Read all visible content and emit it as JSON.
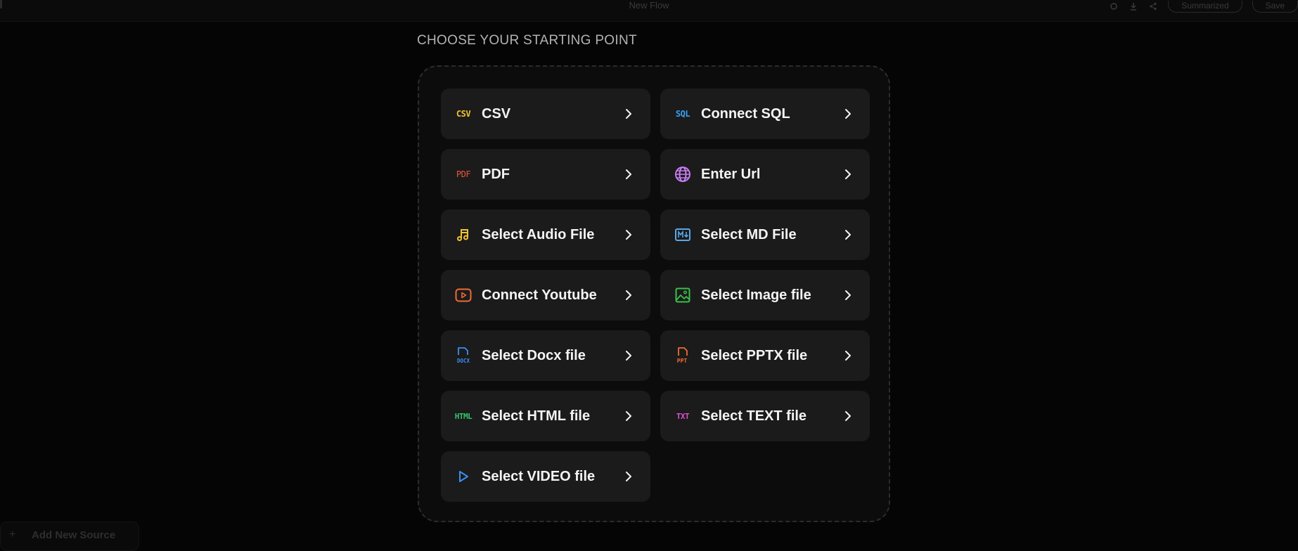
{
  "topbar": {
    "title": "New Flow",
    "right_pills": [
      "Summarized",
      "Save"
    ],
    "right_icons": [
      "gear-icon",
      "download-icon",
      "share-icon"
    ]
  },
  "heading": "CHOOSE YOUR STARTING POINT",
  "sources": [
    {
      "label": "CSV",
      "icon": "csv-icon",
      "icon_text": "CSV",
      "color": "#f2c233"
    },
    {
      "label": "Connect SQL",
      "icon": "sql-icon",
      "icon_text": "SQL",
      "color": "#3aa0f0"
    },
    {
      "label": "PDF",
      "icon": "pdf-icon",
      "icon_text": "PDF",
      "color": "#e8573c"
    },
    {
      "label": "Enter Url",
      "icon": "globe-icon",
      "icon_text": "",
      "color": "#c77cf2"
    },
    {
      "label": "Select Audio File",
      "icon": "music-icon",
      "icon_text": "",
      "color": "#f2c233"
    },
    {
      "label": "Select MD File",
      "icon": "markdown-icon",
      "icon_text": "",
      "color": "#5aa7e8"
    },
    {
      "label": "Connect Youtube",
      "icon": "youtube-icon",
      "icon_text": "",
      "color": "#f06a33"
    },
    {
      "label": "Select Image file",
      "icon": "image-icon",
      "icon_text": "",
      "color": "#3bbf4a"
    },
    {
      "label": "Select Docx file",
      "icon": "docx-icon",
      "icon_text": "DOCX",
      "color": "#3a8ff0"
    },
    {
      "label": "Select PPTX file",
      "icon": "pptx-icon",
      "icon_text": "PPT",
      "color": "#f06a33"
    },
    {
      "label": "Select HTML file",
      "icon": "html-icon",
      "icon_text": "HTML",
      "color": "#35c46a"
    },
    {
      "label": "Select TEXT file",
      "icon": "text-icon",
      "icon_text": "TXT",
      "color": "#d84fd0"
    },
    {
      "label": "Select VIDEO file",
      "icon": "play-icon",
      "icon_text": "",
      "color": "#3a8ff0"
    }
  ],
  "bottom": {
    "add_label": "Add New Source"
  }
}
